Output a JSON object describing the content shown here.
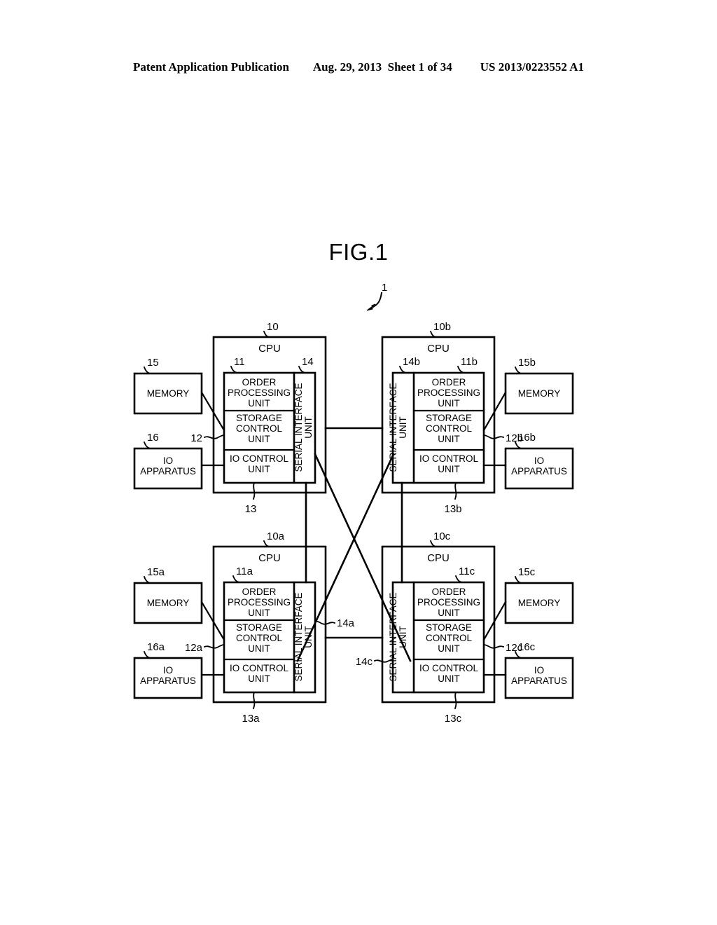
{
  "header": {
    "publication": "Patent Application Publication",
    "date_sheet": "Aug. 29, 2013  Sheet 1 of 34",
    "patent_number": "US 2013/0223552 A1"
  },
  "figure": {
    "title": "FIG.1",
    "system_ref": "1"
  },
  "labels": {
    "cpu": "CPU",
    "order_processing_unit": "ORDER PROCESSING UNIT",
    "storage_control_unit": "STORAGE CONTROL UNIT",
    "io_control_unit": "IO CONTROL UNIT",
    "serial_interface_unit": "SERIAL INTERFACE UNIT",
    "memory": "MEMORY",
    "io_apparatus": "IO APPARATUS"
  },
  "nodes": [
    {
      "id": "tl",
      "cpu_ref": "10",
      "opu_ref": "11",
      "scu_ref": "12",
      "iocu_ref": "13",
      "siu_ref": "14",
      "memory_ref": "15",
      "io_ref": "16",
      "siu_side": "right",
      "periph_side": "left"
    },
    {
      "id": "tr",
      "cpu_ref": "10b",
      "opu_ref": "11b",
      "scu_ref": "12b",
      "iocu_ref": "13b",
      "siu_ref": "14b",
      "memory_ref": "15b",
      "io_ref": "16b",
      "siu_side": "left",
      "periph_side": "right"
    },
    {
      "id": "bl",
      "cpu_ref": "10a",
      "opu_ref": "11a",
      "scu_ref": "12a",
      "iocu_ref": "13a",
      "siu_ref": "14a",
      "memory_ref": "15a",
      "io_ref": "16a",
      "siu_side": "right",
      "periph_side": "left"
    },
    {
      "id": "br",
      "cpu_ref": "10c",
      "opu_ref": "11c",
      "scu_ref": "12c",
      "iocu_ref": "13c",
      "siu_ref": "14c",
      "memory_ref": "15c",
      "io_ref": "16c",
      "siu_side": "left",
      "periph_side": "right"
    }
  ],
  "connections": [
    {
      "from": "14",
      "to": "14b",
      "kind": "horizontal-top"
    },
    {
      "from": "14a",
      "to": "14c",
      "kind": "horizontal-bottom"
    },
    {
      "from": "14",
      "to": "14a",
      "kind": "vertical-left"
    },
    {
      "from": "14b",
      "to": "14c",
      "kind": "vertical-right"
    },
    {
      "from": "14",
      "to": "14c",
      "kind": "diagonal-cross"
    },
    {
      "from": "14b",
      "to": "14a",
      "kind": "diagonal-cross"
    }
  ]
}
